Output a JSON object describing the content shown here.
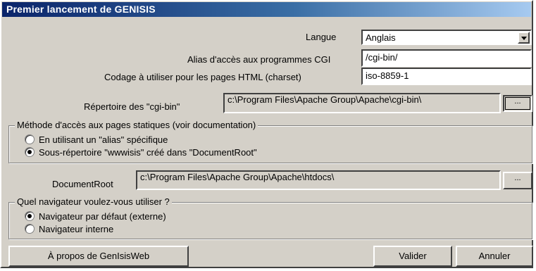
{
  "window": {
    "title": "Premier lancement de GENISIS"
  },
  "settings": {
    "langue_label": "Langue",
    "langue_value": "Anglais",
    "alias_label": "Alias d'accès aux programmes CGI",
    "alias_value": "/cgi-bin/",
    "charset_label": "Codage à utiliser pour les pages HTML (charset)",
    "charset_value": "iso-8859-1",
    "cgibin_label": "Répertoire des \"cgi-bin\"",
    "cgibin_value": "c:\\Program Files\\Apache Group\\Apache\\cgi-bin\\",
    "cgibin_browse": "...",
    "docroot_label": "DocumentRoot",
    "docroot_value": "c:\\Program Files\\Apache Group\\Apache\\htdocs\\",
    "docroot_browse": "..."
  },
  "static_access": {
    "title": "Méthode d'accès aux pages statiques (voir documentation)",
    "options": [
      {
        "label": "En utilisant un \"alias\" spécifique",
        "selected": false
      },
      {
        "label": "Sous-répertoire \"wwwisis\" créé dans \"DocumentRoot\"",
        "selected": true
      }
    ]
  },
  "browser": {
    "title": "Quel navigateur voulez-vous utiliser ?",
    "options": [
      {
        "label": "Navigateur par défaut (externe)",
        "selected": true
      },
      {
        "label": "Navigateur interne",
        "selected": false
      }
    ]
  },
  "footer": {
    "about_label": "À propos de GenIsisWeb",
    "ok_label": "Valider",
    "cancel_label": "Annuler"
  },
  "colors": {
    "face": "#d4d0c8",
    "title_start": "#0a246a",
    "title_end": "#a6caf0"
  }
}
